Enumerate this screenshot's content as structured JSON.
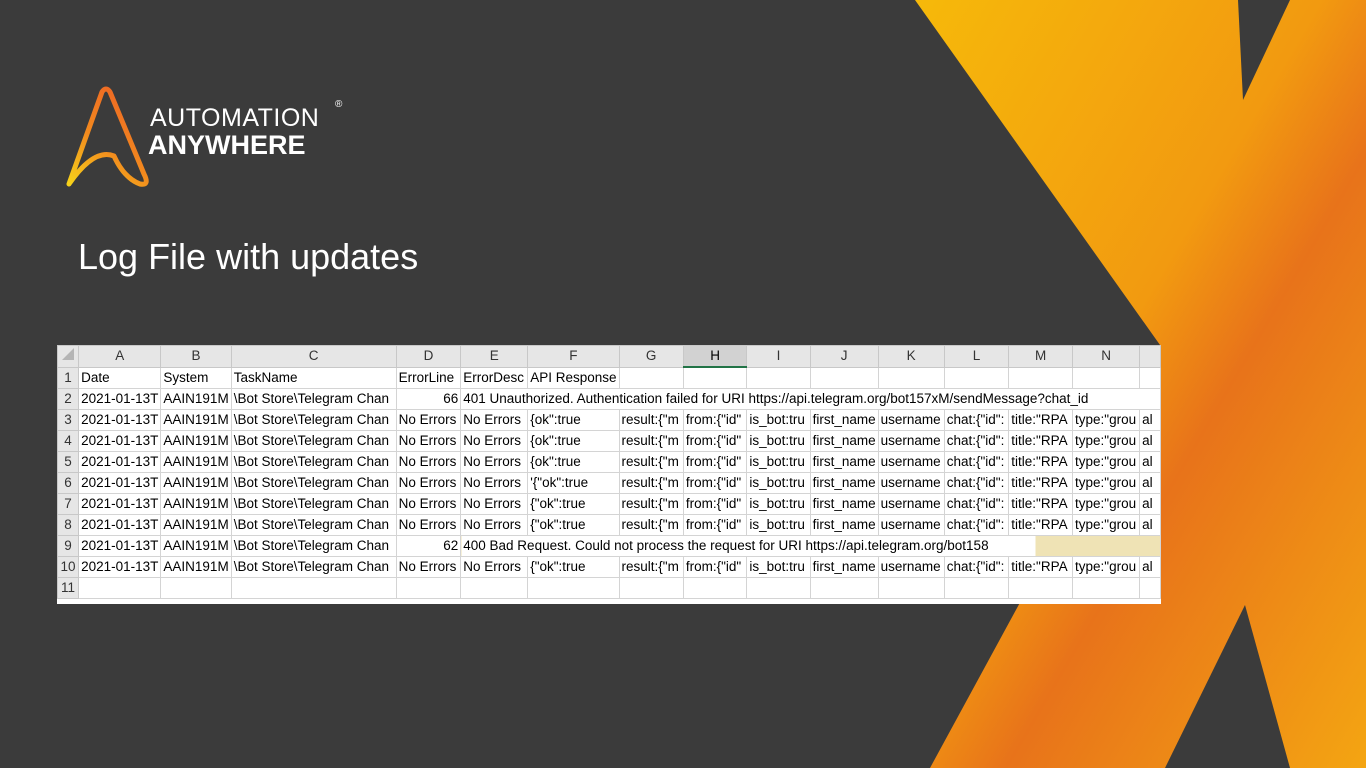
{
  "logo": {
    "line1": "AUTOMATION",
    "line2": "ANYWHERE",
    "reg": "®"
  },
  "slide_title": "Log File with updates",
  "colors": {
    "background": "#3b3b3b",
    "accent_yellow": "#f6b90a",
    "accent_orange": "#e8731a",
    "highlight_cell": "#efe3b5",
    "selected_col_underline": "#217346"
  },
  "sheet": {
    "columns": [
      "A",
      "B",
      "C",
      "D",
      "E",
      "F",
      "G",
      "H",
      "I",
      "J",
      "K",
      "L",
      "M",
      "N"
    ],
    "selected_column": "H",
    "header_row": [
      "Date",
      "System",
      "TaskName",
      "ErrorLine",
      "ErrorDesc",
      "API Response"
    ],
    "rows": [
      {
        "n": "2",
        "date": "2021-01-13T",
        "system": "AAIN191M",
        "task": "\\Bot Store\\Telegram Chan",
        "errline": "66",
        "overflow": "401 Unauthorized. Authentication failed for URI https://api.telegram.org/bot157xM/sendMessage?chat_id"
      },
      {
        "n": "3",
        "date": "2021-01-13T",
        "system": "AAIN191M",
        "task": "\\Bot Store\\Telegram Chan",
        "errline": "No Errors",
        "errdesc": "No Errors",
        "cells": [
          "{ok\":true",
          "result:{\"m",
          "from:{\"id\"",
          "is_bot:tru",
          "first_name",
          "username",
          "chat:{\"id\":",
          "title:\"RPA",
          "type:\"grou",
          "al"
        ]
      },
      {
        "n": "4",
        "date": "2021-01-13T",
        "system": "AAIN191M",
        "task": "\\Bot Store\\Telegram Chan",
        "errline": "No Errors",
        "errdesc": "No Errors",
        "cells": [
          "{ok\":true",
          "result:{\"m",
          "from:{\"id\"",
          "is_bot:tru",
          "first_name",
          "username",
          "chat:{\"id\":",
          "title:\"RPA",
          "type:\"grou",
          "al"
        ]
      },
      {
        "n": "5",
        "date": "2021-01-13T",
        "system": "AAIN191M",
        "task": "\\Bot Store\\Telegram Chan",
        "errline": "No Errors",
        "errdesc": "No Errors",
        "cells": [
          "{ok\":true",
          "result:{\"m",
          "from:{\"id\"",
          "is_bot:tru",
          "first_name",
          "username",
          "chat:{\"id\":",
          "title:\"RPA",
          "type:\"grou",
          "al"
        ]
      },
      {
        "n": "6",
        "date": "2021-01-13T",
        "system": "AAIN191M",
        "task": "\\Bot Store\\Telegram Chan",
        "errline": "No Errors",
        "errdesc": "No Errors",
        "cells": [
          "'{\"ok\":true",
          "result:{\"m",
          "from:{\"id\"",
          "is_bot:tru",
          "first_name",
          "username",
          "chat:{\"id\":",
          "title:\"RPA",
          "type:\"grou",
          "al"
        ]
      },
      {
        "n": "7",
        "date": "2021-01-13T",
        "system": "AAIN191M",
        "task": "\\Bot Store\\Telegram Chan",
        "errline": "No Errors",
        "errdesc": "No Errors",
        "cells": [
          "{\"ok\":true",
          "result:{\"m",
          "from:{\"id\"",
          "is_bot:tru",
          "first_name",
          "username",
          "chat:{\"id\":",
          "title:\"RPA",
          "type:\"grou",
          "al"
        ]
      },
      {
        "n": "8",
        "date": "2021-01-13T",
        "system": "AAIN191M",
        "task": "\\Bot Store\\Telegram Chan",
        "errline": "No Errors",
        "errdesc": "No Errors",
        "cells": [
          "{\"ok\":true",
          "result:{\"m",
          "from:{\"id\"",
          "is_bot:tru",
          "first_name",
          "username",
          "chat:{\"id\":",
          "title:\"RPA",
          "type:\"grou",
          "al"
        ]
      },
      {
        "n": "9",
        "date": "2021-01-13T",
        "system": "AAIN191M",
        "task": "\\Bot Store\\Telegram Chan",
        "errline": "62",
        "overflow": "400 Bad Request. Could not process the request for URI https://api.telegram.org/bot158"
      },
      {
        "n": "10",
        "date": "2021-01-13T",
        "system": "AAIN191M",
        "task": "\\Bot Store\\Telegram Chan",
        "errline": "No Errors",
        "errdesc": "No Errors",
        "cells": [
          "{\"ok\":true",
          "result:{\"m",
          "from:{\"id\"",
          "is_bot:tru",
          "first_name",
          "username",
          "chat:{\"id\":",
          "title:\"RPA",
          "type:\"grou",
          "al"
        ]
      }
    ],
    "empty_row": "11"
  }
}
